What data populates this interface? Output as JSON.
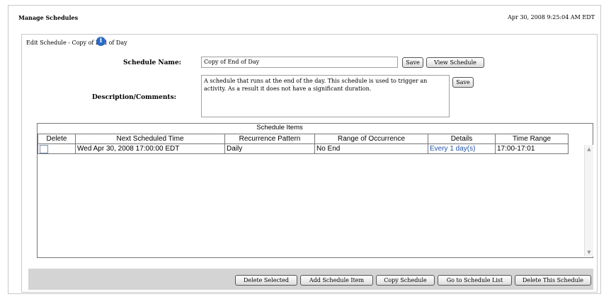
{
  "header": {
    "title": "Manage Schedules",
    "datetime": "Apr 30, 2008 9:25:04 AM EDT"
  },
  "panel": {
    "title": "Edit Schedule - Copy of End of Day",
    "info_icon": "i"
  },
  "form": {
    "name_label": "Schedule Name:",
    "name_value": "Copy of End of Day",
    "save_label": "Save",
    "view_label": "View Schedule",
    "desc_label": "Description/Comments:",
    "desc_value": "A schedule that runs at the end of the day.  This schedule is used to trigger an activity.  As a result it does not have a significant duration.",
    "desc_save_label": "Save"
  },
  "schedule_items": {
    "caption": "Schedule Items",
    "columns": [
      "Delete",
      "Next Scheduled Time",
      "Recurrence Pattern",
      "Range of Occurrence",
      "Details",
      "Time Range"
    ],
    "rows": [
      {
        "delete": false,
        "next": "Wed Apr 30, 2008 17:00:00 EDT",
        "pattern": "Daily",
        "range": "No End",
        "details": "Every 1 day(s)",
        "time": "17:00-17:01"
      }
    ]
  },
  "actions": {
    "delete_selected": "Delete Selected",
    "add_item": "Add Schedule Item",
    "copy": "Copy Schedule",
    "go_list": "Go to Schedule List",
    "delete_schedule": "Delete This Schedule"
  },
  "colors": {
    "info_icon": "#2a6ac8",
    "link": "#2255aa",
    "bottom_bar": "#d4d4d4"
  }
}
